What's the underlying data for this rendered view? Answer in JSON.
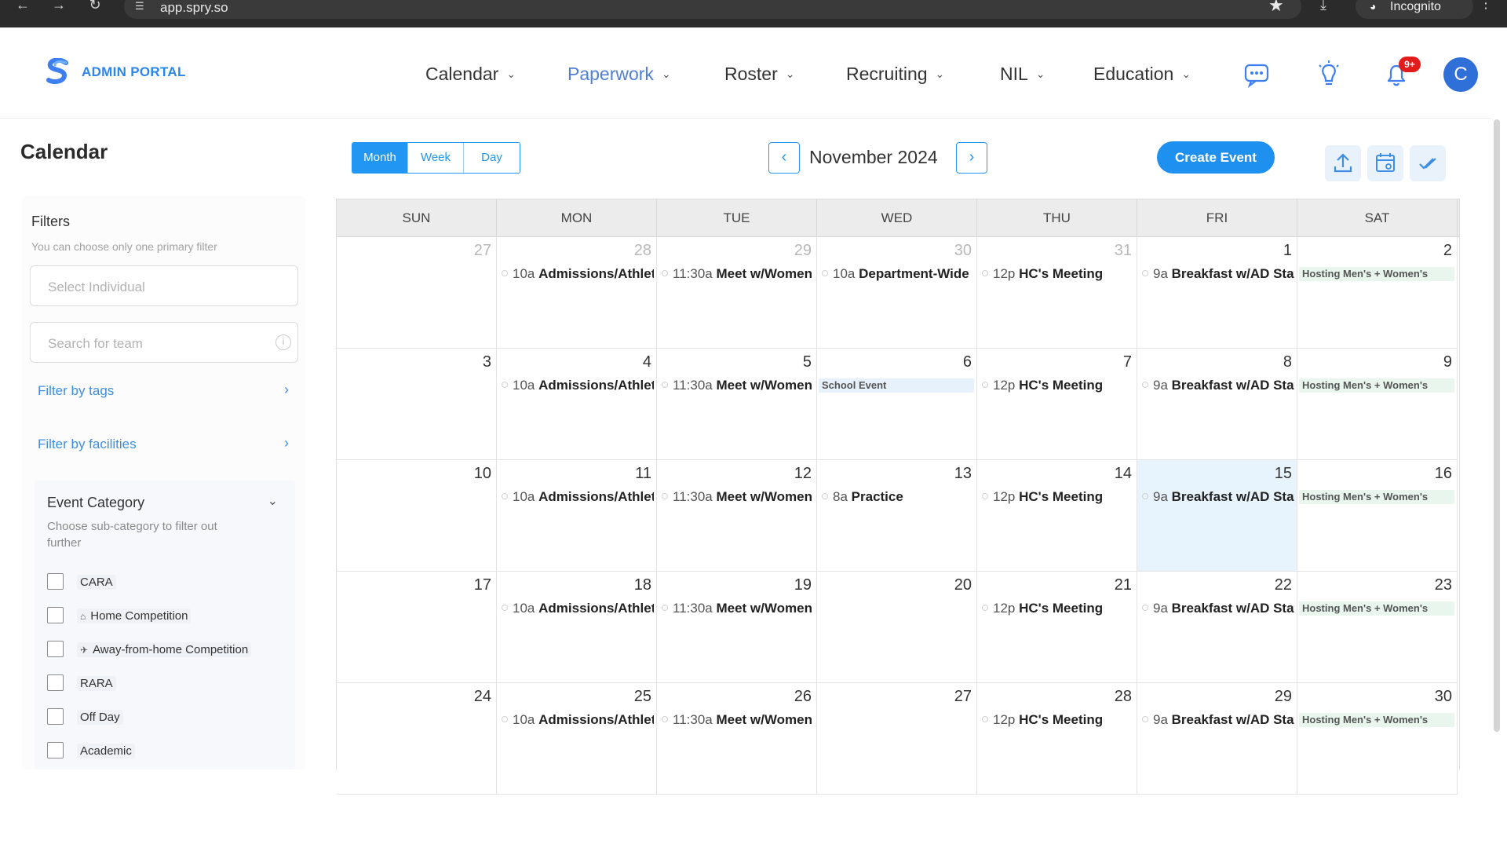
{
  "browser": {
    "url": "app.spry.so",
    "incognito_label": "Incognito"
  },
  "header": {
    "portal_label": "ADMIN PORTAL",
    "nav": [
      {
        "label": "Calendar"
      },
      {
        "label": "Paperwork"
      },
      {
        "label": "Roster"
      },
      {
        "label": "Recruiting"
      },
      {
        "label": "NIL"
      },
      {
        "label": "Education"
      }
    ],
    "notification_badge": "9+",
    "avatar_initial": "C",
    "accent_color": "#1e90f0"
  },
  "sidebar": {
    "page_title": "Calendar",
    "filters_title": "Filters",
    "filters_hint": "You can choose only one primary filter",
    "select_individual_placeholder": "Select Individual",
    "search_team_placeholder": "Search for team",
    "filter_by_tags": "Filter by tags",
    "filter_by_facilities": "Filter by facilities",
    "event_category": {
      "title": "Event Category",
      "hint": "Choose sub-category to filter out further",
      "items": [
        {
          "label": "CARA",
          "icon": ""
        },
        {
          "label": "Home Competition",
          "icon": "home-icon"
        },
        {
          "label": "Away-from-home Competition",
          "icon": "plane-icon"
        },
        {
          "label": "RARA",
          "icon": ""
        },
        {
          "label": "Off Day",
          "icon": ""
        },
        {
          "label": "Academic",
          "icon": ""
        }
      ]
    }
  },
  "toolbar": {
    "views": [
      "Month",
      "Week",
      "Day"
    ],
    "active_view": "Month",
    "month_label": "November 2024",
    "create_event": "Create Event"
  },
  "calendar": {
    "weekdays": [
      "SUN",
      "MON",
      "TUE",
      "WED",
      "THU",
      "FRI",
      "SAT"
    ],
    "weeks": [
      [
        {
          "day": "27",
          "other": true
        },
        {
          "day": "28",
          "other": true,
          "event": {
            "time": "10a",
            "title": "Admissions/Athletics"
          }
        },
        {
          "day": "29",
          "other": true,
          "event": {
            "time": "11:30a",
            "title": "Meet w/Women"
          }
        },
        {
          "day": "30",
          "other": true,
          "event": {
            "time": "10a",
            "title": "Department-Wide"
          }
        },
        {
          "day": "31",
          "other": true,
          "event": {
            "time": "12p",
            "title": "HC's Meeting"
          }
        },
        {
          "day": "1",
          "event": {
            "time": "9a",
            "title": "Breakfast w/AD Staff"
          }
        },
        {
          "day": "2",
          "chip": {
            "text": "Hosting Men's + Women's",
            "color": "green"
          }
        }
      ],
      [
        {
          "day": "3"
        },
        {
          "day": "4",
          "event": {
            "time": "10a",
            "title": "Admissions/Athletics"
          }
        },
        {
          "day": "5",
          "event": {
            "time": "11:30a",
            "title": "Meet w/Women"
          }
        },
        {
          "day": "6",
          "chip": {
            "text": "School Event",
            "color": "blue"
          }
        },
        {
          "day": "7",
          "event": {
            "time": "12p",
            "title": "HC's Meeting"
          }
        },
        {
          "day": "8",
          "event": {
            "time": "9a",
            "title": "Breakfast w/AD Staff"
          }
        },
        {
          "day": "9",
          "chip": {
            "text": "Hosting Men's + Women's",
            "color": "green"
          }
        }
      ],
      [
        {
          "day": "10"
        },
        {
          "day": "11",
          "event": {
            "time": "10a",
            "title": "Admissions/Athletics"
          }
        },
        {
          "day": "12",
          "event": {
            "time": "11:30a",
            "title": "Meet w/Women"
          }
        },
        {
          "day": "13",
          "event": {
            "time": "8a",
            "title": "Practice"
          }
        },
        {
          "day": "14",
          "event": {
            "time": "12p",
            "title": "HC's Meeting"
          }
        },
        {
          "day": "15",
          "today": true,
          "event": {
            "time": "9a",
            "title": "Breakfast w/AD Staff"
          }
        },
        {
          "day": "16",
          "chip": {
            "text": "Hosting Men's + Women's",
            "color": "green"
          }
        }
      ],
      [
        {
          "day": "17"
        },
        {
          "day": "18",
          "event": {
            "time": "10a",
            "title": "Admissions/Athletics"
          }
        },
        {
          "day": "19",
          "event": {
            "time": "11:30a",
            "title": "Meet w/Women"
          }
        },
        {
          "day": "20"
        },
        {
          "day": "21",
          "event": {
            "time": "12p",
            "title": "HC's Meeting"
          }
        },
        {
          "day": "22",
          "event": {
            "time": "9a",
            "title": "Breakfast w/AD Staff"
          }
        },
        {
          "day": "23",
          "chip": {
            "text": "Hosting Men's + Women's",
            "color": "green"
          }
        }
      ],
      [
        {
          "day": "24"
        },
        {
          "day": "25",
          "event": {
            "time": "10a",
            "title": "Admissions/Athletics"
          }
        },
        {
          "day": "26",
          "event": {
            "time": "11:30a",
            "title": "Meet w/Women"
          }
        },
        {
          "day": "27"
        },
        {
          "day": "28",
          "event": {
            "time": "12p",
            "title": "HC's Meeting"
          }
        },
        {
          "day": "29",
          "event": {
            "time": "9a",
            "title": "Breakfast w/AD Staff"
          }
        },
        {
          "day": "30",
          "chip": {
            "text": "Hosting Men's + Women's",
            "color": "green"
          }
        }
      ]
    ]
  }
}
